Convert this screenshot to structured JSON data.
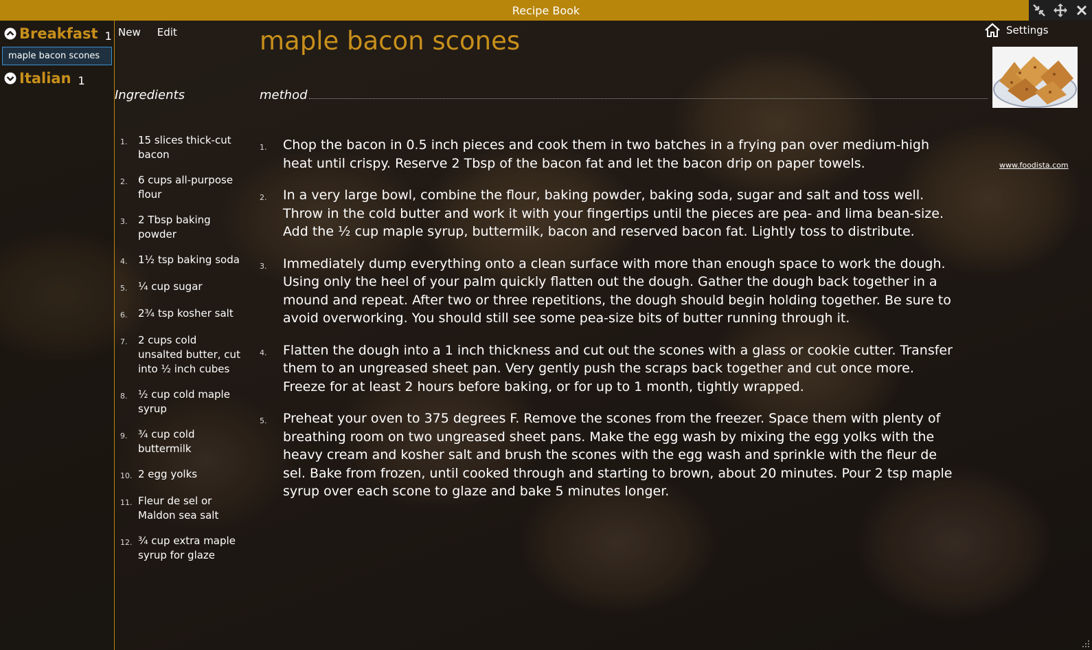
{
  "window": {
    "title": "Recipe Book"
  },
  "sidebar": {
    "groups": [
      {
        "name": "Breakfast",
        "count": "1",
        "icon": "chevron-up-circle-icon",
        "items": [
          "maple bacon scones"
        ]
      },
      {
        "name": "Italian",
        "count": "1",
        "icon": "chevron-down-circle-icon",
        "items": []
      }
    ]
  },
  "menu": {
    "new_label": "New",
    "edit_label": "Edit"
  },
  "ingredients": {
    "heading": "Ingredients",
    "items": [
      {
        "num": "1.",
        "text": "15 slices thick-cut bacon"
      },
      {
        "num": "2.",
        "text": "6 cups all-purpose flour"
      },
      {
        "num": "3.",
        "text": "2 Tbsp baking powder"
      },
      {
        "num": "4.",
        "text": "1½ tsp baking soda"
      },
      {
        "num": "5.",
        "text": "¼ cup sugar"
      },
      {
        "num": "6.",
        "text": "2¾ tsp kosher salt"
      },
      {
        "num": "7.",
        "text": "2 cups cold unsalted butter, cut into ½ inch cubes"
      },
      {
        "num": "8.",
        "text": "½ cup cold maple syrup"
      },
      {
        "num": "9.",
        "text": "¾ cup cold buttermilk"
      },
      {
        "num": "10.",
        "text": "2 egg yolks"
      },
      {
        "num": "11.",
        "text": "Fleur de sel or Maldon sea salt"
      },
      {
        "num": "12.",
        "text": "¾ cup extra maple syrup for glaze"
      }
    ]
  },
  "recipe": {
    "title": "maple bacon scones",
    "method_heading": "method",
    "steps": [
      {
        "num": "1.",
        "text": "Chop the bacon in 0.5 inch pieces and cook them in two batches in a frying pan over medium-high heat until crispy. Reserve 2 Tbsp of the bacon fat and let the bacon drip on paper towels."
      },
      {
        "num": "2.",
        "text": "In a very large bowl, combine the flour, baking powder, baking soda, sugar and salt and toss well. Throw in the cold butter and work it with your fingertips until the pieces are pea- and lima bean-size. Add the ½ cup maple syrup, buttermilk, bacon and reserved bacon fat. Lightly toss to distribute."
      },
      {
        "num": "3.",
        "text": "Immediately dump everything onto a clean surface with more than enough space to work the dough. Using only the heel of your palm quickly flatten out the dough. Gather the dough back together in a mound and repeat. After two or three repetitions, the dough should begin holding together. Be sure to avoid overworking. You should still see some pea-size bits of butter running through it."
      },
      {
        "num": "4.",
        "text": "Flatten the dough into a 1 inch thickness and cut out the scones with a glass or cookie cutter. Transfer them to an ungreased sheet pan. Very gently push the scraps back together and cut once more. Freeze for at least 2 hours before baking, or for up to 1 month, tightly wrapped."
      },
      {
        "num": "5.",
        "text": "Preheat your oven to 375 degrees F. Remove the scones from the freezer. Space them with plenty of breathing room on two ungreased sheet pans. Make the egg wash by mixing the egg yolks with the heavy cream and kosher salt and brush the scones with the egg wash and sprinkle with the fleur de sel. Bake from frozen, until cooked through and starting to brown, about 20 minutes. Pour 2 tsp maple syrup over each scone to glaze and bake 5 minutes longer."
      }
    ]
  },
  "right_pane": {
    "settings_label": "Settings",
    "settings_icon": "home-icon",
    "source_link": "www.foodista.com"
  },
  "colors": {
    "accent": "#b8860b",
    "heading": "#c8901b",
    "selection_border": "#3c8fd0"
  }
}
